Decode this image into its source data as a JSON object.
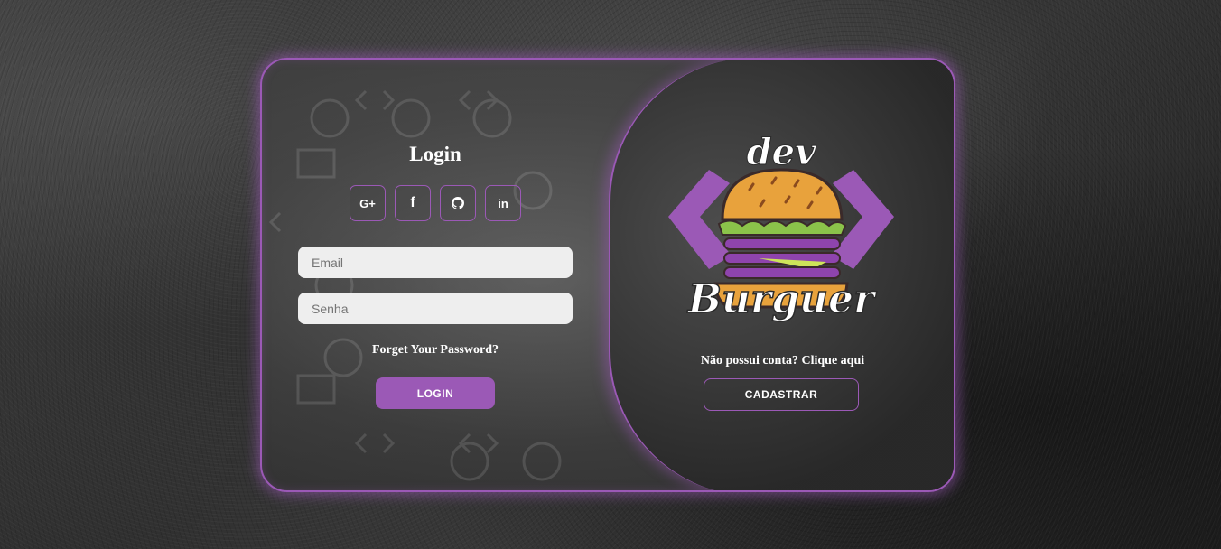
{
  "login": {
    "title": "Login",
    "social": [
      {
        "icon": "google-plus-icon",
        "glyph": "G+"
      },
      {
        "icon": "facebook-icon",
        "glyph": "f"
      },
      {
        "icon": "github-icon",
        "glyph": "github"
      },
      {
        "icon": "linkedin-icon",
        "glyph": "in"
      }
    ],
    "email_placeholder": "Email",
    "password_placeholder": "Senha",
    "forget_label": "Forget Your Password?",
    "login_button": "LOGIN"
  },
  "brand": {
    "logo_top": "dev",
    "logo_bottom": "Burguer"
  },
  "signup": {
    "prompt": "Não possui conta? Clique aqui",
    "button": "CADASTRAR"
  },
  "colors": {
    "accent": "#9b59b6",
    "input_bg": "#eeeeee",
    "text": "#ffffff",
    "bun": "#e8a23c",
    "lettuce": "#8bc34a"
  }
}
